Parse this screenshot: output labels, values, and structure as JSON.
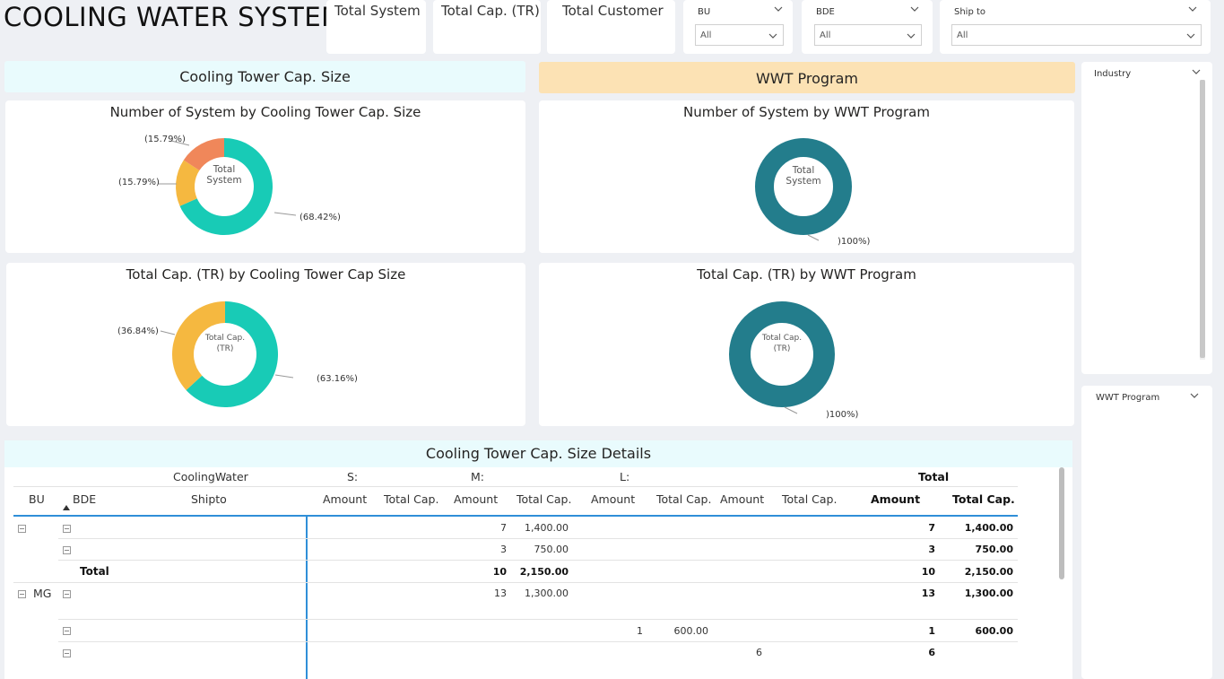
{
  "title": "COOLING WATER SYSTEM",
  "kpis": [
    "Total System",
    "Total Cap. (TR)",
    "Total Customer"
  ],
  "slicers": {
    "bu": {
      "label": "BU",
      "value": "All"
    },
    "bde": {
      "label": "BDE",
      "value": "All"
    },
    "shipto": {
      "label": "Ship to",
      "value": "All"
    },
    "industry": {
      "label": "Industry"
    },
    "wwt": {
      "label": "WWT Program"
    }
  },
  "sections": {
    "left": "Cooling Tower Cap. Size",
    "right": "WWT Program",
    "details": "Cooling Tower Cap. Size Details"
  },
  "colors": {
    "teal": "#18cbb6",
    "yellow": "#f5b840",
    "orange": "#f0875a",
    "dark_teal": "#237d8c",
    "left_head_bg": "#e9fbfd",
    "right_head_bg": "#fce2b4"
  },
  "chart_data": [
    {
      "type": "pie",
      "title": "Number of System by Cooling Tower Cap. Size",
      "center_label": [
        "Total",
        "System"
      ],
      "slices": [
        {
          "value": 68.42,
          "label": "(68.42%)",
          "color": "#18cbb6"
        },
        {
          "value": 15.79,
          "label": "(15.79%)",
          "color": "#f5b840"
        },
        {
          "value": 15.79,
          "label": "(15.79%)",
          "color": "#f0875a"
        }
      ]
    },
    {
      "type": "pie",
      "title": "Number of System by WWT Program",
      "center_label": [
        "Total",
        "System"
      ],
      "slices": [
        {
          "value": 100,
          "label": ")100%)",
          "color": "#237d8c"
        }
      ]
    },
    {
      "type": "pie",
      "title": "Total Cap. (TR) by Cooling Tower Cap Size",
      "center_label": [
        "Total Cap.",
        "(TR)"
      ],
      "slices": [
        {
          "value": 63.16,
          "label": "(63.16%)",
          "color": "#18cbb6"
        },
        {
          "value": 36.84,
          "label": "(36.84%)",
          "color": "#f5b840"
        }
      ]
    },
    {
      "type": "pie",
      "title": "Total Cap. (TR) by WWT Program",
      "center_label": [
        "Total Cap.",
        "(TR)"
      ],
      "slices": [
        {
          "value": 100,
          "label": ")100%)",
          "color": "#237d8c"
        }
      ]
    }
  ],
  "matrix": {
    "row_group": "CoolingWater",
    "col_groups": [
      "S:",
      "M:",
      "L:",
      "",
      "Total"
    ],
    "columns": [
      "BU",
      "BDE",
      "Shipto",
      "Amount",
      "Total Cap.",
      "Amount",
      "Total Cap.",
      "Amount",
      "Total Cap.",
      "Amount",
      "Total Cap.",
      "Amount",
      "Total Cap."
    ],
    "total_label": "Total",
    "bu_mg": "MG",
    "rows": [
      {
        "m_amount": "7",
        "m_cap": "1,400.00",
        "t_amount": "7",
        "t_cap": "1,400.00"
      },
      {
        "m_amount": "3",
        "m_cap": "750.00",
        "t_amount": "3",
        "t_cap": "750.00"
      },
      {
        "m_amount": "10",
        "m_cap": "2,150.00",
        "t_amount": "10",
        "t_cap": "2,150.00"
      },
      {
        "m_amount": "13",
        "m_cap": "1,300.00",
        "t_amount": "13",
        "t_cap": "1,300.00"
      },
      {
        "l_amount": "1",
        "l_cap": "600.00",
        "t_amount": "1",
        "t_cap": "600.00"
      },
      {
        "x_amount": "6",
        "t_amount": "6"
      }
    ]
  }
}
